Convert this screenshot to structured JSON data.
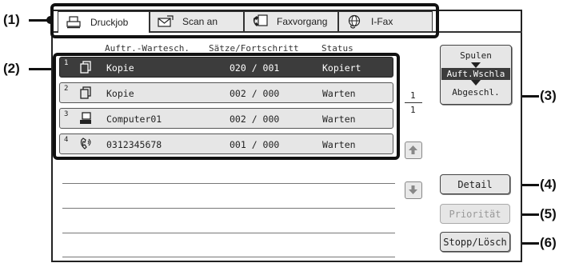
{
  "callouts": {
    "c1": "(1)",
    "c2": "(2)",
    "c3": "(3)",
    "c4": "(4)",
    "c5": "(5)",
    "c6": "(6)"
  },
  "tabs": [
    {
      "label": "Druckjob",
      "icon": "printer-icon"
    },
    {
      "label": "Scan an",
      "icon": "scan-send-icon"
    },
    {
      "label": "Faxvorgang",
      "icon": "fax-icon"
    },
    {
      "label": "I-Fax",
      "icon": "internet-fax-icon"
    }
  ],
  "headers": {
    "queue": "Auftr.-Wartesch.",
    "sets": "Sätze/Fortschritt",
    "status": "Status"
  },
  "jobs": [
    {
      "num": "1",
      "name": "Kopie",
      "sets": "020 / 001",
      "status": "Kopiert",
      "icon": "copy-icon"
    },
    {
      "num": "2",
      "name": "Kopie",
      "sets": "002 / 000",
      "status": "Warten",
      "icon": "copy-icon"
    },
    {
      "num": "3",
      "name": "Computer01",
      "sets": "002 / 000",
      "status": "Warten",
      "icon": "computer-icon"
    },
    {
      "num": "4",
      "name": "0312345678",
      "sets": "001 / 000",
      "status": "Warten",
      "icon": "phone-icon"
    }
  ],
  "pager": {
    "current": "1",
    "total": "1"
  },
  "mode_switch": {
    "top": "Spulen",
    "middle": "Auft.Wschla",
    "bottom": "Abgeschl."
  },
  "buttons": {
    "detail": "Detail",
    "priority": "Priorität",
    "stop": "Stopp/Lösch"
  }
}
